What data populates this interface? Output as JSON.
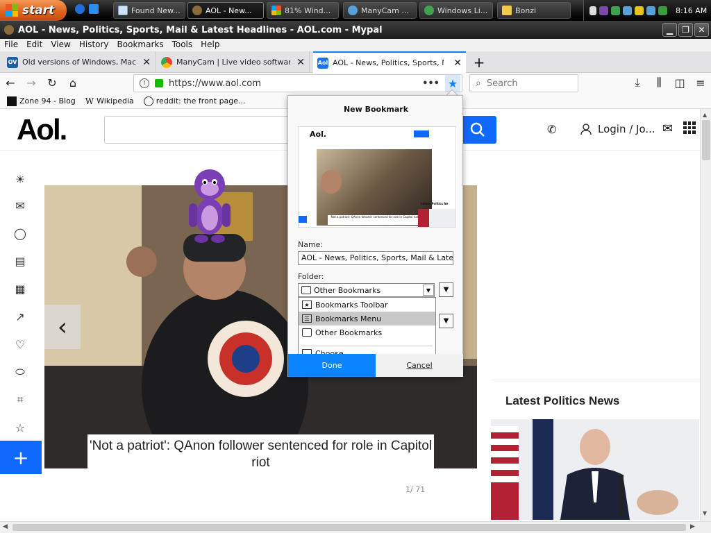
{
  "taskbar": {
    "start_label": "start",
    "buttons": [
      {
        "label": "Found New..."
      },
      {
        "label": "AOL - New..."
      },
      {
        "label": "81% Wind..."
      },
      {
        "label": "ManyCam ..."
      },
      {
        "label": "Windows Li..."
      },
      {
        "label": "Bonzi"
      }
    ],
    "clock": "8:16 AM"
  },
  "window": {
    "title": "AOL - News, Politics, Sports, Mail & Latest Headlines - AOL.com - Mypal"
  },
  "menubar": [
    "File",
    "Edit",
    "View",
    "History",
    "Bookmarks",
    "Tools",
    "Help"
  ],
  "tabs": [
    {
      "label": "Old versions of Windows, Mac and",
      "favicon_text": "OV"
    },
    {
      "label": "ManyCam | Live video software &",
      "favicon_text": ""
    },
    {
      "label": "AOL - News, Politics, Sports, Mail",
      "favicon_text": "Aol"
    }
  ],
  "nav": {
    "url": "https://www.aol.com",
    "search_placeholder": "Search",
    "more_label": "•••"
  },
  "bookmarks_bar": [
    {
      "label": "Zone 94 - Blog"
    },
    {
      "label": "Wikipedia",
      "icon_text": "W"
    },
    {
      "label": "reddit: the front page..."
    }
  ],
  "aol": {
    "logo": "Aol.",
    "login": "Login / Jo...",
    "hero_caption": "'Not a patriot': QAnon follower sentenced for role in Capitol riot",
    "counter": "1/ 71",
    "politics_title": "Latest Politics News"
  },
  "popup": {
    "title": "New Bookmark",
    "preview_logo": "Aol.",
    "preview_caption": "'Not a patriot': QAnon follower sentenced for role in Capitol riot",
    "preview_side": "Latest Politics Ne",
    "name_label": "Name:",
    "name_value": "AOL - News, Politics, Sports, Mail & Latest He",
    "folder_label": "Folder:",
    "folder_value": "Other Bookmarks",
    "folder_options": [
      "Bookmarks Toolbar",
      "Bookmarks Menu",
      "Other Bookmarks",
      "Choose..."
    ],
    "highlighted_option": "Bookmarks Menu",
    "done_label": "Done",
    "cancel_label": "Cancel"
  },
  "colors": {
    "accent_blue": "#0a84ff",
    "aol_blue": "#0f69ff",
    "start_orange": "#e0631f"
  }
}
